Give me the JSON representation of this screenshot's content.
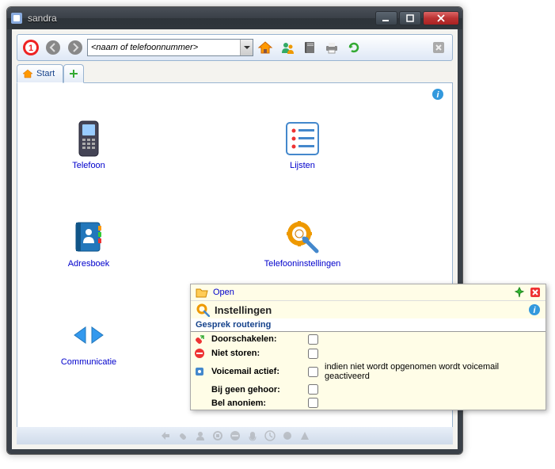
{
  "window": {
    "title": "sandra"
  },
  "toolbar": {
    "search_placeholder": "<naam of telefoonnummer>"
  },
  "tabs": {
    "start_label": "Start"
  },
  "launchers": {
    "telefoon": "Telefoon",
    "lijsten": "Lijsten",
    "adresboek": "Adresboek",
    "telefooninstellingen": "Telefooninstellingen",
    "communicatie": "Communicatie"
  },
  "popup": {
    "open": "Open",
    "title": "Instellingen",
    "section": "Gesprek routering",
    "doorschakelen": "Doorschakelen:",
    "niet_storen": "Niet storen:",
    "voicemail_actief": "Voicemail actief:",
    "voicemail_hint": "indien niet wordt opgenomen wordt voicemail geactiveerd",
    "bij_geen_gehoor": "Bij geen gehoor:",
    "bel_anoniem": "Bel anoniem:"
  }
}
